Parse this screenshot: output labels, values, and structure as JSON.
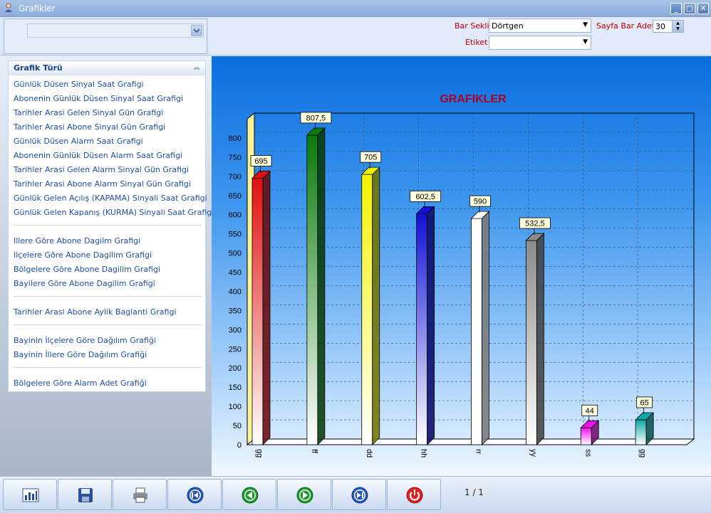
{
  "window": {
    "title": "Grafikler"
  },
  "toolbar": {
    "bar_sekli_label": "Bar Sekli",
    "bar_sekli_value": "Dörtgen",
    "etiket_label": "Etiket",
    "etiket_value": "",
    "sayfa_bar_adeti_label": "Sayfa Bar Adeti",
    "sayfa_bar_adeti_value": "30"
  },
  "task_panel": {
    "title": "Grafik Türü",
    "groups": [
      [
        "Günlük Düsen Sinyal Saat Grafigi",
        "Abonenin Günlük Düsen Sinyal Saat Grafigi",
        "Tarihler Arasi Gelen Sinyal Gün Grafigi",
        "Tarihler Arasi Abone Sinyal Gün  Grafigi",
        "Günlük Düsen Alarm Saat Grafigi",
        "Abonenin Günlük Düsen Alarm Saat Grafigi",
        "Tarihler Arasi Gelen Alarm Sinyal Gün Grafigi",
        "Tarihler Arasi Abone Alarm Sinyal Gün  Grafigi",
        "Günlük Gelen Açılış (KAPAMA) Sinyali Saat Grafigi",
        "Günlük Gelen Kapanış (KURMA) Sinyali Saat Grafigi"
      ],
      [
        "Illere Göre Abone Dagilm Grafigi",
        "Ilçelere Göre Abone Dagilim Grafigi",
        "Bölgelere Göre Abone Dagilim Grafigi",
        "Bayilere Göre Abone Dagilim Grafigi"
      ],
      [
        "Tarihler Arasi Abone Aylik Baglanti Grafigi"
      ],
      [
        "Bayinin İlçelere Göre Dağılım Grafiği",
        "Bayinin İllere Göre Dağılım Grafiği"
      ],
      [
        "Bölgelere Göre Alarm  Adet Grafiği"
      ]
    ]
  },
  "chart_data": {
    "type": "bar",
    "title": "GRAFIKLER",
    "categories": [
      "gg",
      "ff",
      "dd",
      "hh",
      "rr",
      "yy",
      "ss",
      "gg"
    ],
    "values": [
      695,
      807.5,
      705,
      602.5,
      590,
      532.5,
      44,
      65
    ],
    "value_labels": [
      "695",
      "807,5",
      "705",
      "602,5",
      "590",
      "532,5",
      "44",
      "65"
    ],
    "colors": [
      "#e01010",
      "#0a7a0a",
      "#f2f200",
      "#1010d8",
      "#ffffff",
      "#8a8a8a",
      "#f010f0",
      "#0ea6a6"
    ],
    "ylim": [
      0,
      850
    ],
    "yticks": [
      0,
      50,
      100,
      150,
      200,
      250,
      300,
      350,
      400,
      450,
      500,
      550,
      600,
      650,
      700,
      750,
      800
    ],
    "grid": true,
    "style": "3d"
  },
  "bottom": {
    "pager": "1 / 1",
    "buttons": [
      "chart-icon",
      "save-icon",
      "print-icon",
      "first-page-icon",
      "previous-icon",
      "next-icon",
      "last-page-icon",
      "power-icon"
    ]
  }
}
